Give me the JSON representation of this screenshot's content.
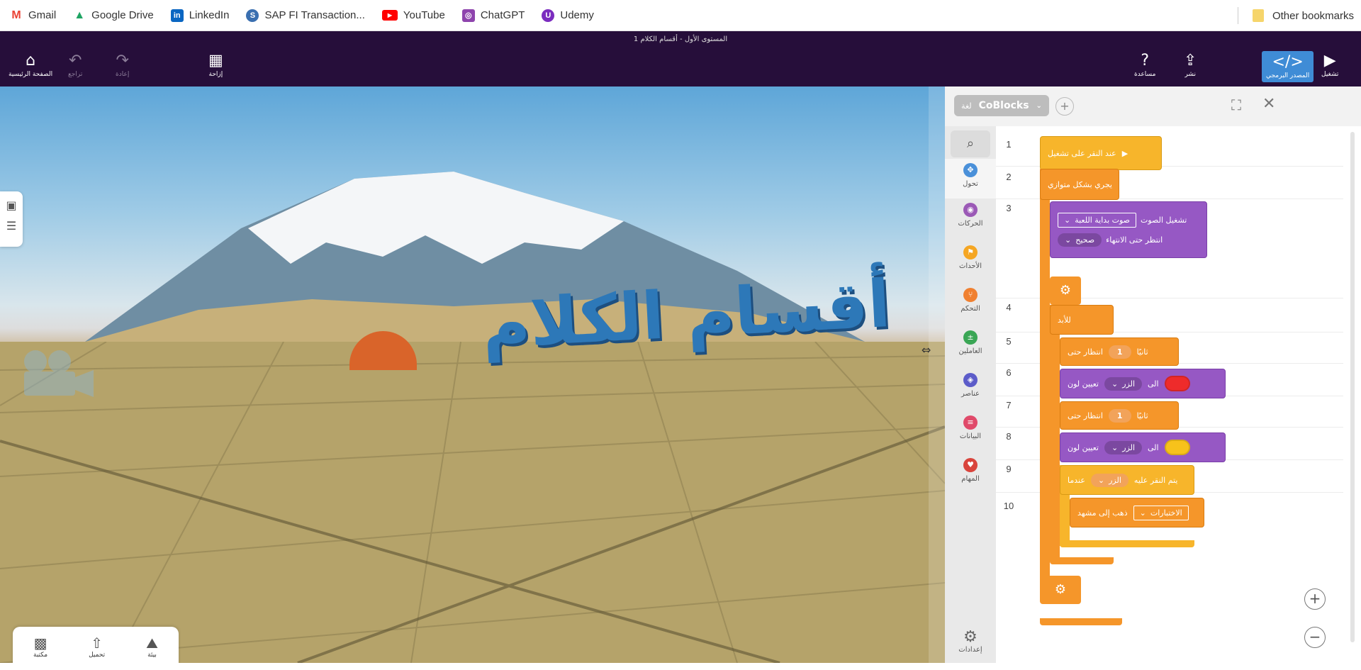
{
  "bookmarks": {
    "items": [
      {
        "label": "Gmail",
        "icon": "gmail-icon",
        "color": "#ea4335"
      },
      {
        "label": "Google Drive",
        "icon": "google-drive-icon",
        "color": "#1fa463"
      },
      {
        "label": "LinkedIn",
        "icon": "linkedin-icon",
        "color": "#0a66c2"
      },
      {
        "label": "SAP FI Transaction...",
        "icon": "sap-icon",
        "color": "#3a6fb0"
      },
      {
        "label": "YouTube",
        "icon": "youtube-icon",
        "color": "#ff0000"
      },
      {
        "label": "ChatGPT",
        "icon": "chatgpt-icon",
        "color": "#8e44ad"
      },
      {
        "label": "Udemy",
        "icon": "udemy-icon",
        "color": "#7b2cbf"
      }
    ],
    "other": "Other bookmarks"
  },
  "app": {
    "doc_title": "المستوى الأول - أقسام الكلام 1",
    "home": "الصفحة الرئيسية",
    "undo": "تراجع",
    "redo": "إعادة",
    "layout": "إزاحة",
    "help": "مساعدة",
    "share": "نشر",
    "code": "المصدر البرمجي",
    "play": "تشغيل"
  },
  "scene": {
    "title_3d": "أقسام الكلام",
    "tools": {
      "library": "مكتبة",
      "upload": "تحميل",
      "environment": "بيئة"
    }
  },
  "panel": {
    "language": "CoBlocks",
    "language_prefix": "لغة",
    "categories": [
      {
        "label": "تحول",
        "color": "#4a90d9",
        "icon": "move-icon"
      },
      {
        "label": "الحركات",
        "color": "#9b59b6",
        "icon": "eye-icon"
      },
      {
        "label": "الأحداث",
        "color": "#f5a623",
        "icon": "event-icon"
      },
      {
        "label": "التحكم",
        "color": "#f08030",
        "icon": "control-icon"
      },
      {
        "label": "العاملين",
        "color": "#3aa655",
        "icon": "operators-icon"
      },
      {
        "label": "عناصر",
        "color": "#5c5cc9",
        "icon": "items-icon"
      },
      {
        "label": "البيانات",
        "color": "#e04a6a",
        "icon": "data-icon"
      },
      {
        "label": "المهام",
        "color": "#d9443c",
        "icon": "functions-icon"
      }
    ],
    "settings": "إعدادات",
    "line_numbers": [
      "1",
      "2",
      "3",
      "4",
      "5",
      "6",
      "7",
      "8",
      "9",
      "10"
    ],
    "blocks": {
      "on_play": "عند النقر على تشغيل",
      "parallel": "يجري بشكل متوازي",
      "play_sound": "تشغيل الصوت",
      "sound_name": "صوت بداية اللعبة",
      "wait_end": "انتظر حتى الانتهاء",
      "wait_value": "صحيح",
      "forever": "للأبد",
      "wait": "انتظار حتى",
      "seconds": "ثانيًا",
      "wait_amount": "1",
      "set_color": "تعيين لون",
      "target": "الزر",
      "to": "الى",
      "color_red": "#ee2b2b",
      "color_yellow": "#f7c21b",
      "when": "عندما",
      "clicked": "يتم النقر عليه",
      "goto_scene": "ذهب إلى مشهد",
      "scene_name": "الاختبارات"
    }
  }
}
